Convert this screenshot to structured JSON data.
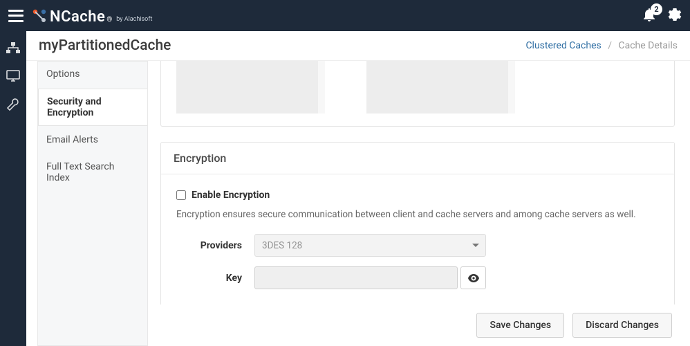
{
  "header": {
    "logo_text": "NCache",
    "logo_sub": "by Alachisoft",
    "notification_count": "2"
  },
  "subheader": {
    "title": "myPartitionedCache",
    "crumb_parent": "Clustered Caches",
    "crumb_current": "Cache Details"
  },
  "sidebar": {
    "items": [
      {
        "label": "Options"
      },
      {
        "label": "Security and Encryption"
      },
      {
        "label": "Email Alerts"
      },
      {
        "label": "Full Text Search Index"
      }
    ]
  },
  "encryption": {
    "panel_title": "Encryption",
    "enable_label": "Enable Encryption",
    "description": "Encryption ensures secure communication between client and cache servers and among cache servers as well.",
    "providers_label": "Providers",
    "providers_value": "3DES 128",
    "key_label": "Key",
    "key_value": ""
  },
  "footer": {
    "save": "Save Changes",
    "discard": "Discard Changes"
  }
}
